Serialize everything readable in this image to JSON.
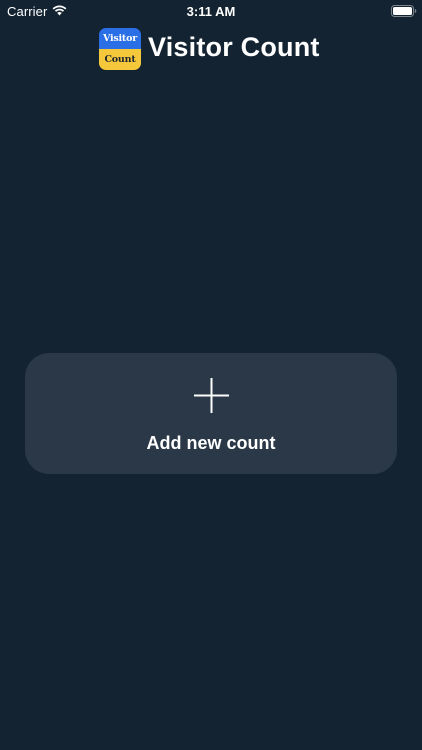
{
  "status_bar": {
    "carrier": "Carrier",
    "time": "3:11 AM",
    "wifi_icon": "wifi-icon",
    "battery_icon": "battery-full-icon"
  },
  "header": {
    "logo": {
      "top_text": "Visitor",
      "bottom_text": "Count",
      "top_color": "#2a6fe6",
      "bottom_color": "#f5c83c"
    },
    "title": "Visitor Count"
  },
  "main": {
    "add_card": {
      "icon": "plus-icon",
      "label": "Add new count"
    }
  },
  "colors": {
    "background": "#132331",
    "card": "#2a3847",
    "text": "#ffffff"
  }
}
